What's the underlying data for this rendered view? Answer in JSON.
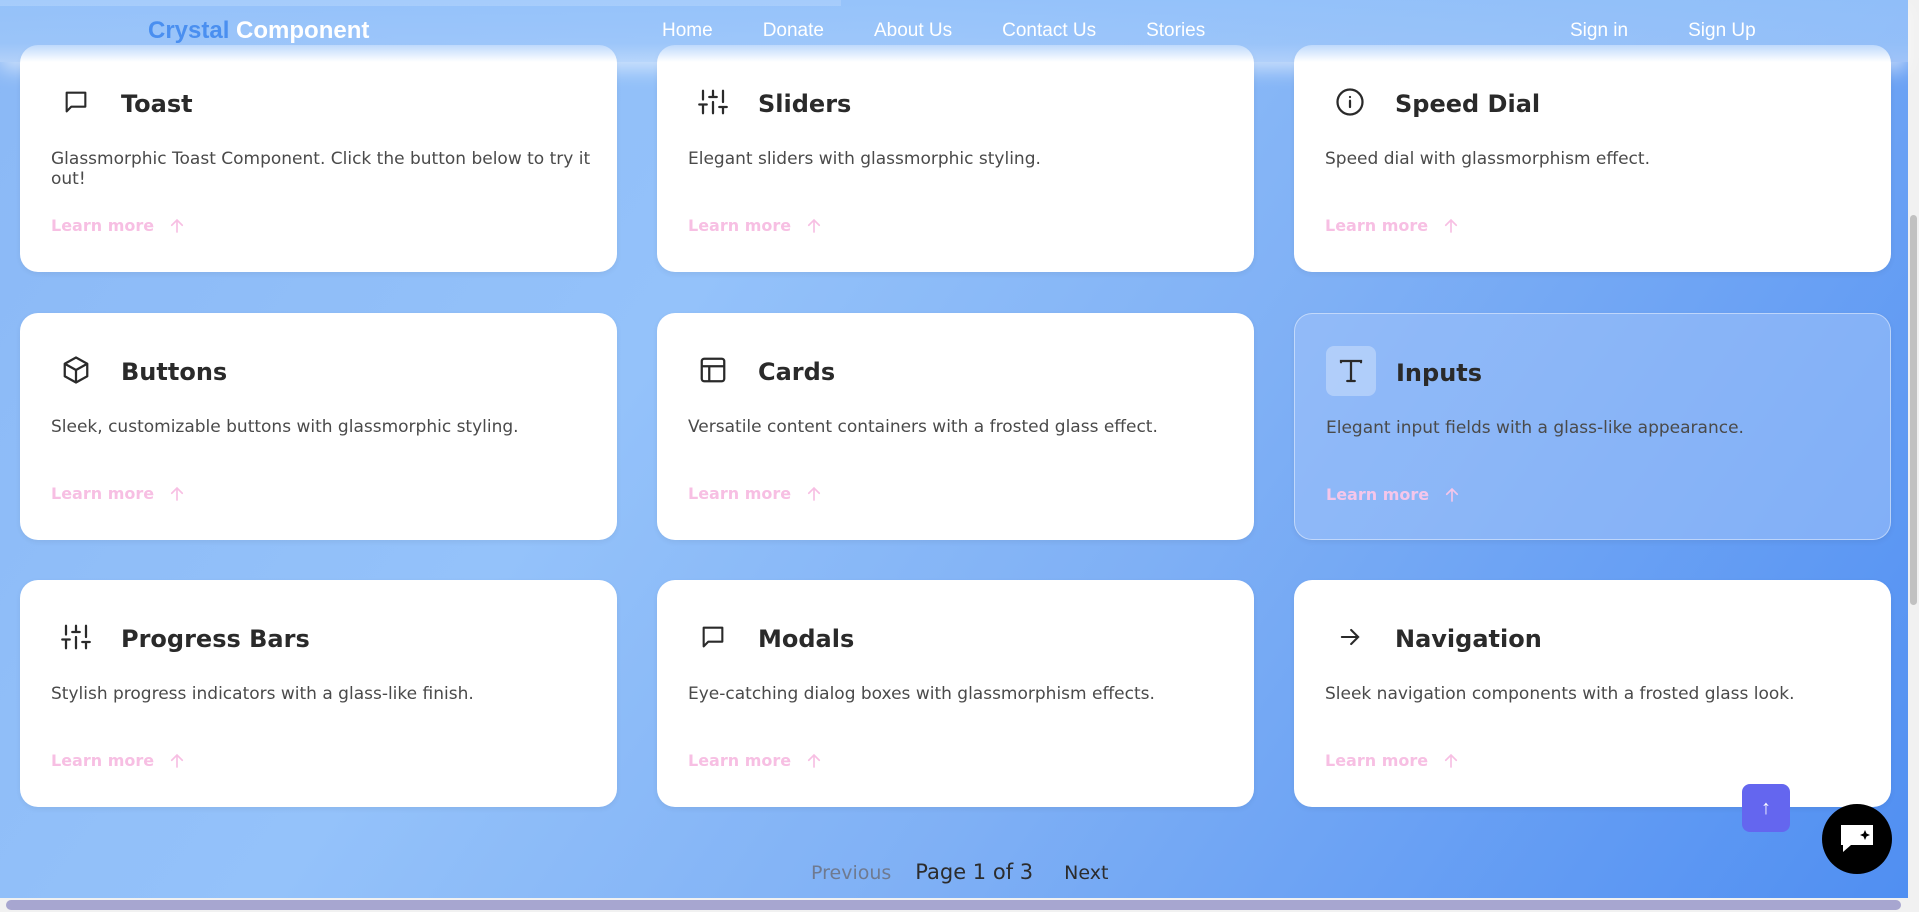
{
  "navbar": {
    "brand_part1": "Crystal",
    "brand_part2": "Component",
    "links": [
      "Home",
      "Donate",
      "About Us",
      "Contact Us",
      "Stories"
    ],
    "sign_in": "Sign in",
    "sign_up": "Sign Up"
  },
  "cards": [
    {
      "title": "Toast",
      "desc": "Glassmorphic Toast Component. Click the button below to try it out!",
      "link": "Learn more",
      "icon": "message-square-icon"
    },
    {
      "title": "Sliders",
      "desc": "Elegant sliders with glassmorphic styling.",
      "link": "Learn more",
      "icon": "sliders-icon"
    },
    {
      "title": "Speed Dial",
      "desc": "Speed dial with glassmorphism effect.",
      "link": "Learn more",
      "icon": "info-icon"
    },
    {
      "title": "Buttons",
      "desc": "Sleek, customizable buttons with glassmorphic styling.",
      "link": "Learn more",
      "icon": "box-icon"
    },
    {
      "title": "Cards",
      "desc": "Versatile content containers with a frosted glass effect.",
      "link": "Learn more",
      "icon": "layout-icon"
    },
    {
      "title": "Inputs",
      "desc": "Elegant input fields with a glass-like appearance.",
      "link": "Learn more",
      "icon": "type-icon"
    },
    {
      "title": "Progress Bars",
      "desc": "Stylish progress indicators with a glass-like finish.",
      "link": "Learn more",
      "icon": "sliders-icon"
    },
    {
      "title": "Modals",
      "desc": "Eye-catching dialog boxes with glassmorphism effects.",
      "link": "Learn more",
      "icon": "message-square-icon"
    },
    {
      "title": "Navigation",
      "desc": "Sleek navigation components with a frosted glass look.",
      "link": "Learn more",
      "icon": "arrow-right-icon"
    }
  ],
  "pagination": {
    "previous": "Previous",
    "info": "Page 1 of 3",
    "next": "Next"
  },
  "floating": {
    "to_top": "↑"
  },
  "colors": {
    "accent": "#6466ef",
    "learn_more": "#f7bfe3",
    "brand_blue": "#4a8ff0"
  }
}
